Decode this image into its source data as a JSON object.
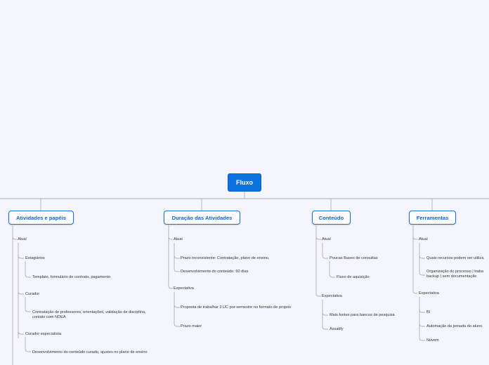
{
  "root": {
    "label": "Fluxo"
  },
  "branches": [
    {
      "label": "Atividades e papéis",
      "groups": [
        {
          "label": "Atual",
          "items": [
            {
              "label": "Estagiários",
              "children": [
                "Template, formulário de contrato, pagamento"
              ]
            },
            {
              "label": "Curador",
              "children": [
                "Contratação de professores, orientações, validação de disciplina, contato com NDEA"
              ]
            },
            {
              "label": "Curador especialista",
              "children": [
                "Desenvolvimento do conteúdo curado, ajustes no plano de ensino"
              ]
            }
          ]
        }
      ]
    },
    {
      "label": "Duração das Atividades",
      "groups": [
        {
          "label": "Atual",
          "items": [
            "Prazo inconsistente: Contratação, plano de ensino,",
            "Desenvolvimento do conteúdo: 60 dias"
          ]
        },
        {
          "label": "Expectativa",
          "items": [
            "Proposta de trabalhar 3 UC por semestre no formato de projeto",
            "Prazo maior"
          ]
        }
      ]
    },
    {
      "label": "Conteúdo",
      "groups": [
        {
          "label": "Atual",
          "items": [
            {
              "label": "Poucas Bases de consultas",
              "children": [
                "Fluxo de aquisição"
              ]
            }
          ]
        },
        {
          "label": "Expectativa",
          "items": [
            "Mais fontes para bancos de pesquisa",
            "Assatify"
          ]
        }
      ]
    },
    {
      "label": "Ferramentas",
      "groups": [
        {
          "label": "Atual",
          "items": [
            "Quais recursos podem ser utiliza",
            "Organização do processo | traba backup | sem documentação"
          ]
        },
        {
          "label": "Expectativa",
          "items": [
            "BI",
            "Automação da jornada do aluno",
            "Nuvem"
          ]
        }
      ]
    }
  ]
}
